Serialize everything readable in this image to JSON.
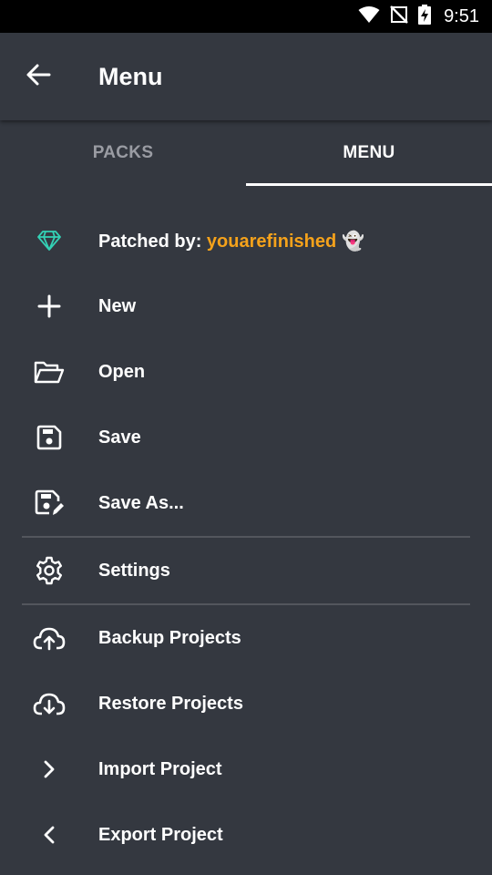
{
  "status_bar": {
    "time": "9:51",
    "icons": [
      "wifi-icon",
      "no-signal-icon",
      "battery-charging-icon"
    ]
  },
  "app_bar": {
    "title": "Menu",
    "back_icon": "arrow-left-icon"
  },
  "tabs": [
    {
      "label": "PACKS",
      "active": false
    },
    {
      "label": "MENU",
      "active": true
    }
  ],
  "patched": {
    "prefix": "Patched by: ",
    "user": "youarefinished",
    "emoji": "👻",
    "icon": "diamond-icon",
    "accent_color": "#f5a21b",
    "icon_color": "#33d1b5"
  },
  "menu": {
    "items": [
      {
        "label": "New",
        "icon": "plus-icon"
      },
      {
        "label": "Open",
        "icon": "folder-open-icon"
      },
      {
        "label": "Save",
        "icon": "save-icon"
      },
      {
        "label": "Save As...",
        "icon": "save-as-icon"
      },
      {
        "label": "Settings",
        "icon": "gear-icon"
      },
      {
        "label": "Backup Projects",
        "icon": "cloud-upload-icon"
      },
      {
        "label": "Restore Projects",
        "icon": "cloud-download-icon"
      },
      {
        "label": "Import Project",
        "icon": "chevron-right-icon"
      },
      {
        "label": "Export Project",
        "icon": "chevron-left-icon"
      }
    ]
  },
  "colors": {
    "background": "#343840",
    "divider": "#53565d",
    "tab_inactive": "#9a9ca3",
    "text": "#ffffff"
  }
}
